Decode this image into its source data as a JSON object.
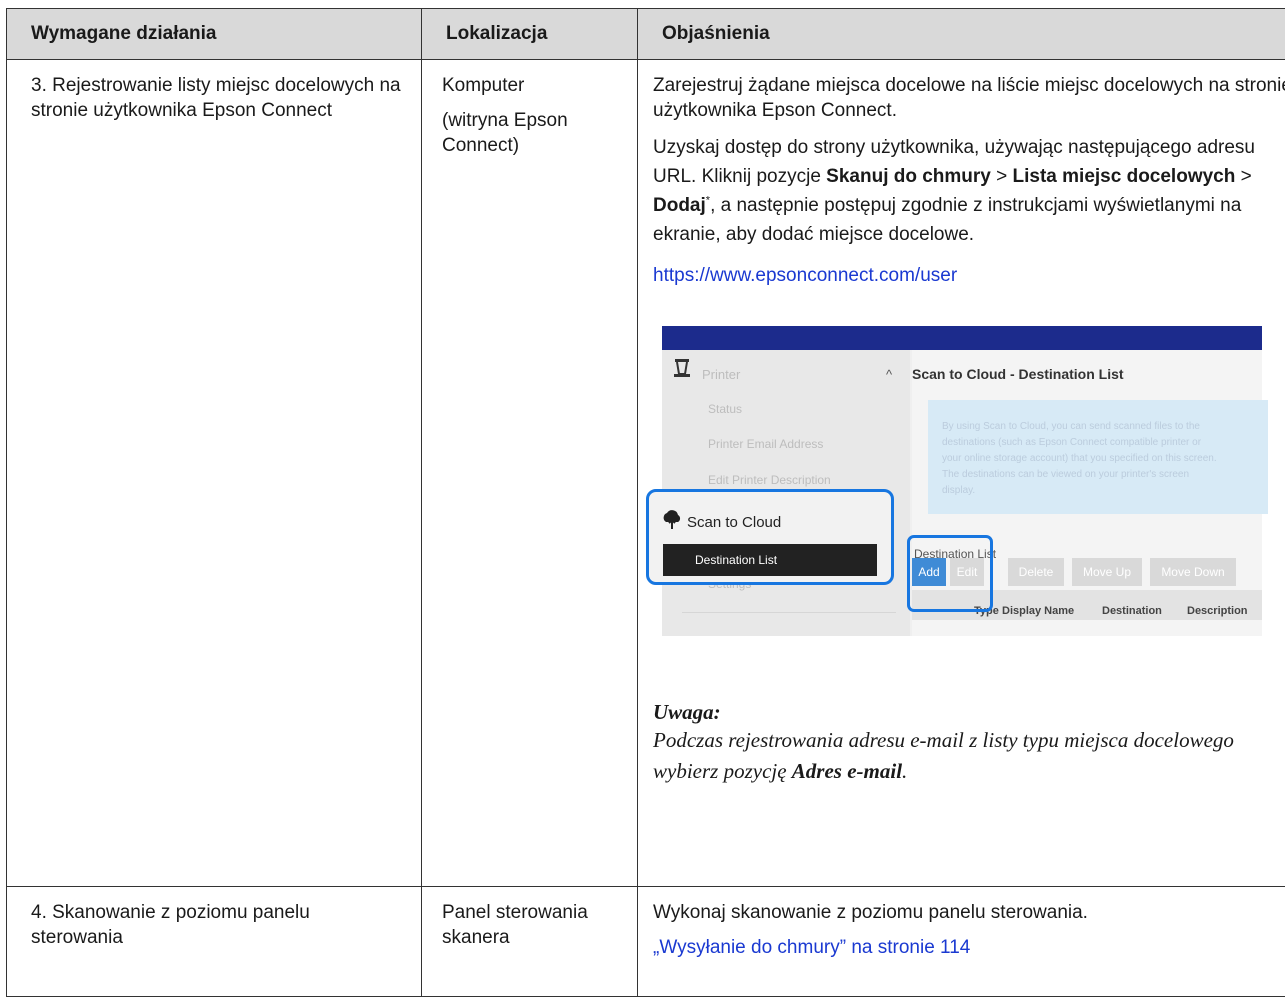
{
  "table": {
    "headers": [
      "Wymagane działania",
      "Lokalizacja",
      "Objaśnienia"
    ],
    "row1": {
      "action": "3. Rejestrowanie listy miejsc docelowych na stronie użytkownika Epson Connect",
      "location_1": "Komputer",
      "location_2": "(witryna Epson Connect)",
      "para1": "Zarejestruj żądane miejsca docelowe na liście miejsc docelowych na stronie użytkownika Epson Connect.",
      "para2_a": "Uzyskaj dostęp do strony użytkownika, używając następującego adresu URL. Kliknij pozycje ",
      "para2_b1": "Skanuj do chmury",
      "para2_sep1": " > ",
      "para2_b2": "Lista miejsc docelowych",
      "para2_sep2": " > ",
      "para2_b3": "Dodaj",
      "para2_sup": "*",
      "para2_c": ", a następnie postępuj zgodnie z instrukcjami wyświetlanymi na ekranie, aby dodać miejsce docelowe.",
      "url": "https://www.epsonconnect.com/user",
      "note_title": "Uwaga:",
      "note_a": "Podczas rejestrowania adresu e-mail z listy typu miejsca docelowego wybierz pozycję ",
      "note_b": "Adres e-mail",
      "note_c": "."
    },
    "row2": {
      "action": "4. Skanowanie z poziomu panelu sterowania",
      "location": "Panel sterowania skanera",
      "para": "Wykonaj skanowanie z poziomu panelu sterowania.",
      "link": "„Wysyłanie do chmury” na stronie 114"
    }
  },
  "screenshot": {
    "sidebar_printer": "Printer",
    "sidebar_status": "Status",
    "sidebar_email": "Printer Email Address",
    "sidebar_edit": "Edit Printer Description",
    "scan_to_cloud": "Scan to Cloud",
    "destination_list": "Destination List",
    "sidebar_settings": "Settings",
    "page_title": "Scan to Cloud - Destination List",
    "info_lines": [
      "By using Scan to Cloud, you can send scanned files to the",
      "destinations (such as Epson Connect compatible printer or",
      "your online storage account) that you specified on this screen.",
      "The destinations can be viewed on your printer's screen",
      "display."
    ],
    "dest_label": "Destination List",
    "buttons": [
      "Add",
      "Edit",
      "Delete",
      "Move Up",
      "Move Down"
    ],
    "columns": [
      "Type",
      "Display Name",
      "Destination",
      "Description"
    ]
  }
}
